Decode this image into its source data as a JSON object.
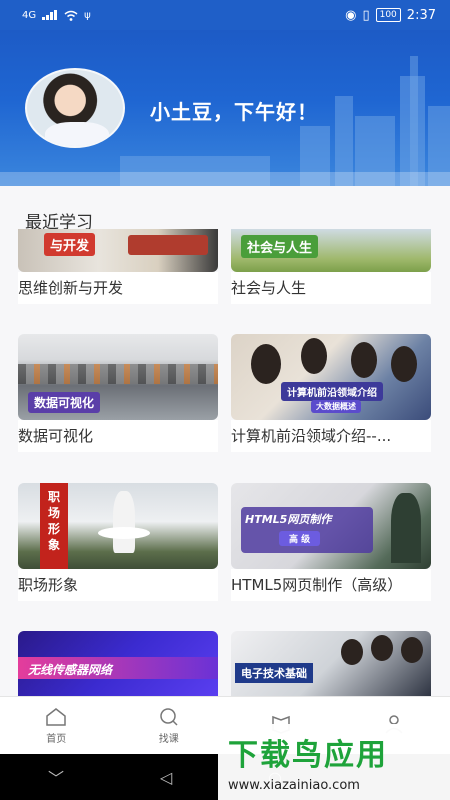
{
  "status_bar": {
    "signal": "4G",
    "time": "2:37",
    "battery": "100"
  },
  "header": {
    "greeting": "小土豆，下午好！"
  },
  "section": {
    "title": "最近学习"
  },
  "courses": [
    {
      "title": "思维创新与开发",
      "thumb_text": "与开发"
    },
    {
      "title": "社会与人生",
      "thumb_text": "社会与人生"
    },
    {
      "title": "数据可视化",
      "thumb_text": "数据可视化"
    },
    {
      "title": "计算机前沿领域介绍--...",
      "thumb_text": "计算机前沿领域介绍",
      "thumb_subtext": "大数据概述"
    },
    {
      "title": "职场形象",
      "thumb_text": "职场形象"
    },
    {
      "title": "HTML5网页制作（高级）",
      "thumb_text": "HTML5网页制作",
      "thumb_subtext": "高 级"
    },
    {
      "title": "",
      "thumb_text": "无线传感器网络"
    },
    {
      "title": "",
      "thumb_text": "电子技术基础"
    }
  ],
  "bottom_nav": {
    "items": [
      {
        "label": "首页",
        "icon": "home-icon"
      },
      {
        "label": "找课",
        "icon": "search-icon"
      },
      {
        "label": "",
        "icon": "book-icon"
      },
      {
        "label": "",
        "icon": "profile-icon"
      }
    ]
  },
  "watermark": {
    "logo": "下载鸟应用",
    "url": "www.xiazainiao.com"
  }
}
